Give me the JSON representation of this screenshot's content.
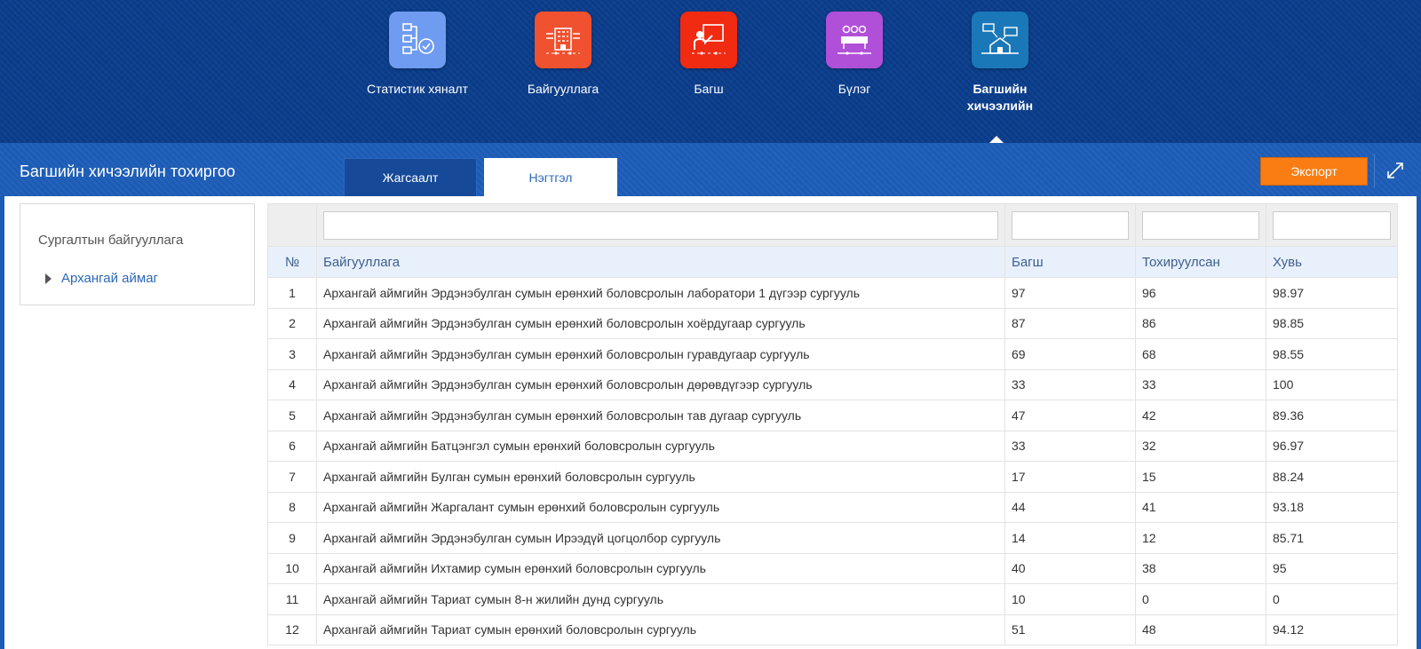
{
  "nav": {
    "items": [
      {
        "label": "Статистик хяналт",
        "icon": "statistics-icon",
        "color": "#6f9bf0",
        "active": false
      },
      {
        "label": "Байгууллага",
        "icon": "organization-icon",
        "color": "#f0512f",
        "active": false
      },
      {
        "label": "Багш",
        "icon": "teacher-icon",
        "color": "#f12a12",
        "active": false
      },
      {
        "label": "Бүлэг",
        "icon": "group-icon",
        "color": "#b04fd8",
        "active": false
      },
      {
        "label": "Багшийн хичээлийн",
        "icon": "teacher-lesson-icon",
        "color": "#1b78b8",
        "active": true
      }
    ]
  },
  "header": {
    "title": "Багшийн хичээлийн тохиргоо",
    "tabs": [
      {
        "label": "Жагсаалт",
        "active": false
      },
      {
        "label": "Нэгтгэл",
        "active": true
      }
    ],
    "export_label": "Экспорт"
  },
  "tree": {
    "title": "Сургалтын байгууллага",
    "node_label": "Архангай аймаг"
  },
  "table": {
    "columns": [
      "№",
      "Байгууллага",
      "Багш",
      "Тохируулсан",
      "Хувь"
    ],
    "rows": [
      [
        "1",
        "Архангай аймгийн Эрдэнэбулган сумын ерөнхий боловсролын лаборатори 1 дүгээр сургууль",
        "97",
        "96",
        "98.97"
      ],
      [
        "2",
        "Архангай аймгийн Эрдэнэбулган сумын ерөнхий боловсролын хоёрдугаар сургууль",
        "87",
        "86",
        "98.85"
      ],
      [
        "3",
        "Архангай аймгийн Эрдэнэбулган сумын ерөнхий боловсролын гуравдугаар сургууль",
        "69",
        "68",
        "98.55"
      ],
      [
        "4",
        "Архангай аймгийн Эрдэнэбулган сумын ерөнхий боловсролын дөрөвдүгээр сургууль",
        "33",
        "33",
        "100"
      ],
      [
        "5",
        "Архангай аймгийн Эрдэнэбулган сумын ерөнхий боловсролын тав дугаар сургууль",
        "47",
        "42",
        "89.36"
      ],
      [
        "6",
        "Архангай аймгийн Батцэнгэл сумын ерөнхий боловсролын сургууль",
        "33",
        "32",
        "96.97"
      ],
      [
        "7",
        "Архангай аймгийн Булган сумын ерөнхий боловсролын сургууль",
        "17",
        "15",
        "88.24"
      ],
      [
        "8",
        "Архангай аймгийн Жаргалант сумын ерөнхий боловсролын сургууль",
        "44",
        "41",
        "93.18"
      ],
      [
        "9",
        "Архангай аймгийн Эрдэнэбулган сумын Ирээдүй цогцолбор сургууль",
        "14",
        "12",
        "85.71"
      ],
      [
        "10",
        "Архангай аймгийн Ихтамир сумын ерөнхий боловсролын сургууль",
        "40",
        "38",
        "95"
      ],
      [
        "11",
        "Архангай аймгийн Тариат сумын 8-н жилийн дунд сургууль",
        "10",
        "0",
        "0"
      ],
      [
        "12",
        "Архангай аймгийн Тариат сумын ерөнхий боловсролын сургууль",
        "51",
        "48",
        "94.12"
      ]
    ]
  }
}
